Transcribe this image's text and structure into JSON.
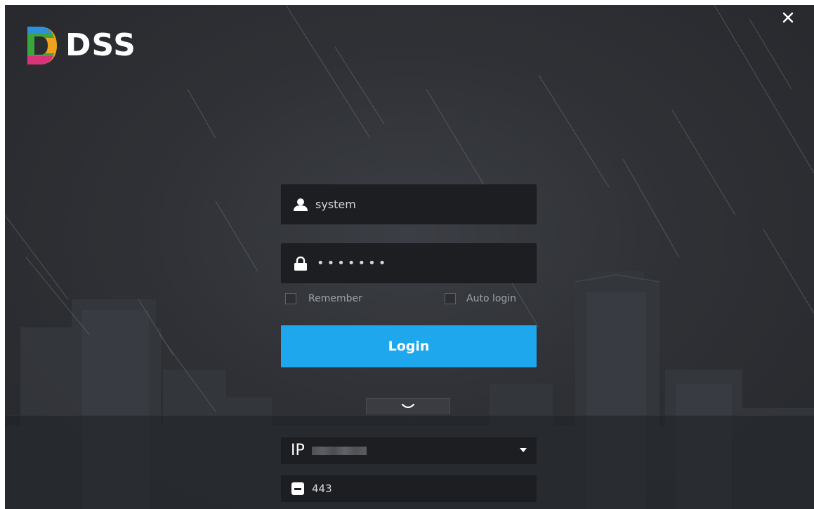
{
  "app": {
    "logo_text": "DSS"
  },
  "login_form": {
    "username_value": "system",
    "password_mask": "•••••••",
    "remember_label": "Remember",
    "auto_login_label": "Auto login",
    "login_button_label": "Login"
  },
  "server": {
    "ip_label": "IP",
    "port_value": "443"
  },
  "icons": {
    "close": "close-icon",
    "user": "user-icon",
    "lock": "lock-icon",
    "expand": "chevron-down-icon",
    "dropdown": "caret-down-icon",
    "port": "port-icon"
  },
  "colors": {
    "accent": "#1ea7ec",
    "background": "#2f3136",
    "field_bg": "#1d1e21"
  }
}
